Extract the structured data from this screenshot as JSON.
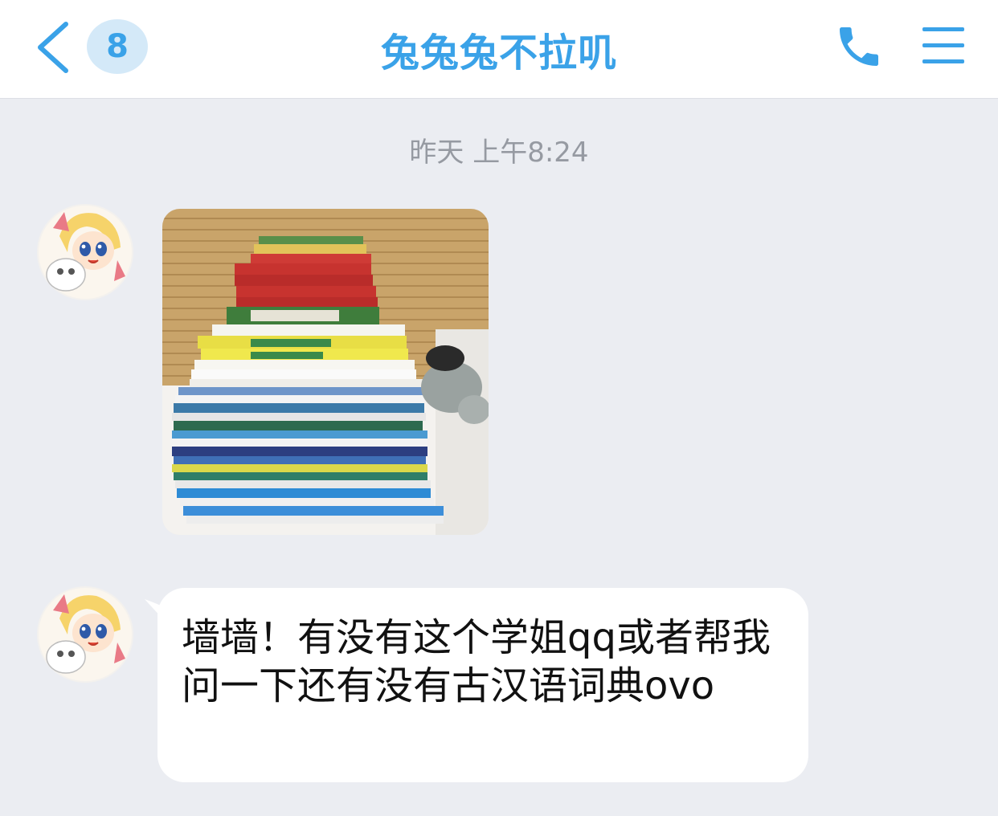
{
  "header": {
    "back_icon": "chevron-left-icon",
    "unread_count": "8",
    "title": "兔兔兔不拉叽",
    "phone_icon": "phone-icon",
    "menu_icon": "menu-icon"
  },
  "chat": {
    "timestamp": "昨天 上午8:24",
    "messages": [
      {
        "type": "image",
        "content": "photo of a stack of textbooks"
      },
      {
        "type": "text",
        "text": "墙墙！有没有这个学姐qq或者帮我问一下还有没有古汉语词典ovo"
      }
    ]
  },
  "colors": {
    "accent": "#3aa2e8",
    "chat_background": "#ebedf2",
    "bubble": "#ffffff",
    "timestamp": "#969aa2"
  }
}
